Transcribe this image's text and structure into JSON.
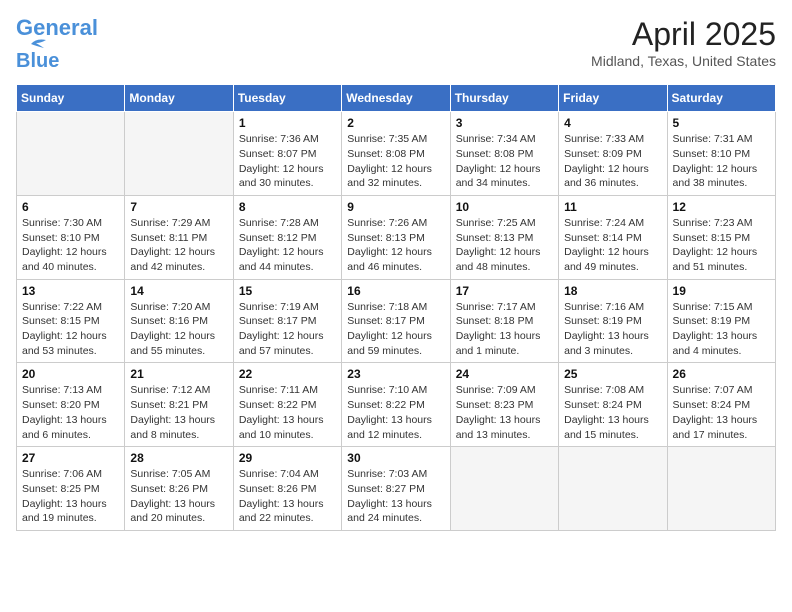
{
  "header": {
    "logo_line1": "General",
    "logo_line2": "Blue",
    "month_title": "April 2025",
    "location": "Midland, Texas, United States"
  },
  "days_of_week": [
    "Sunday",
    "Monday",
    "Tuesday",
    "Wednesday",
    "Thursday",
    "Friday",
    "Saturday"
  ],
  "weeks": [
    [
      {
        "day": "",
        "info": ""
      },
      {
        "day": "",
        "info": ""
      },
      {
        "day": "1",
        "info": "Sunrise: 7:36 AM\nSunset: 8:07 PM\nDaylight: 12 hours and 30 minutes."
      },
      {
        "day": "2",
        "info": "Sunrise: 7:35 AM\nSunset: 8:08 PM\nDaylight: 12 hours and 32 minutes."
      },
      {
        "day": "3",
        "info": "Sunrise: 7:34 AM\nSunset: 8:08 PM\nDaylight: 12 hours and 34 minutes."
      },
      {
        "day": "4",
        "info": "Sunrise: 7:33 AM\nSunset: 8:09 PM\nDaylight: 12 hours and 36 minutes."
      },
      {
        "day": "5",
        "info": "Sunrise: 7:31 AM\nSunset: 8:10 PM\nDaylight: 12 hours and 38 minutes."
      }
    ],
    [
      {
        "day": "6",
        "info": "Sunrise: 7:30 AM\nSunset: 8:10 PM\nDaylight: 12 hours and 40 minutes."
      },
      {
        "day": "7",
        "info": "Sunrise: 7:29 AM\nSunset: 8:11 PM\nDaylight: 12 hours and 42 minutes."
      },
      {
        "day": "8",
        "info": "Sunrise: 7:28 AM\nSunset: 8:12 PM\nDaylight: 12 hours and 44 minutes."
      },
      {
        "day": "9",
        "info": "Sunrise: 7:26 AM\nSunset: 8:13 PM\nDaylight: 12 hours and 46 minutes."
      },
      {
        "day": "10",
        "info": "Sunrise: 7:25 AM\nSunset: 8:13 PM\nDaylight: 12 hours and 48 minutes."
      },
      {
        "day": "11",
        "info": "Sunrise: 7:24 AM\nSunset: 8:14 PM\nDaylight: 12 hours and 49 minutes."
      },
      {
        "day": "12",
        "info": "Sunrise: 7:23 AM\nSunset: 8:15 PM\nDaylight: 12 hours and 51 minutes."
      }
    ],
    [
      {
        "day": "13",
        "info": "Sunrise: 7:22 AM\nSunset: 8:15 PM\nDaylight: 12 hours and 53 minutes."
      },
      {
        "day": "14",
        "info": "Sunrise: 7:20 AM\nSunset: 8:16 PM\nDaylight: 12 hours and 55 minutes."
      },
      {
        "day": "15",
        "info": "Sunrise: 7:19 AM\nSunset: 8:17 PM\nDaylight: 12 hours and 57 minutes."
      },
      {
        "day": "16",
        "info": "Sunrise: 7:18 AM\nSunset: 8:17 PM\nDaylight: 12 hours and 59 minutes."
      },
      {
        "day": "17",
        "info": "Sunrise: 7:17 AM\nSunset: 8:18 PM\nDaylight: 13 hours and 1 minute."
      },
      {
        "day": "18",
        "info": "Sunrise: 7:16 AM\nSunset: 8:19 PM\nDaylight: 13 hours and 3 minutes."
      },
      {
        "day": "19",
        "info": "Sunrise: 7:15 AM\nSunset: 8:19 PM\nDaylight: 13 hours and 4 minutes."
      }
    ],
    [
      {
        "day": "20",
        "info": "Sunrise: 7:13 AM\nSunset: 8:20 PM\nDaylight: 13 hours and 6 minutes."
      },
      {
        "day": "21",
        "info": "Sunrise: 7:12 AM\nSunset: 8:21 PM\nDaylight: 13 hours and 8 minutes."
      },
      {
        "day": "22",
        "info": "Sunrise: 7:11 AM\nSunset: 8:22 PM\nDaylight: 13 hours and 10 minutes."
      },
      {
        "day": "23",
        "info": "Sunrise: 7:10 AM\nSunset: 8:22 PM\nDaylight: 13 hours and 12 minutes."
      },
      {
        "day": "24",
        "info": "Sunrise: 7:09 AM\nSunset: 8:23 PM\nDaylight: 13 hours and 13 minutes."
      },
      {
        "day": "25",
        "info": "Sunrise: 7:08 AM\nSunset: 8:24 PM\nDaylight: 13 hours and 15 minutes."
      },
      {
        "day": "26",
        "info": "Sunrise: 7:07 AM\nSunset: 8:24 PM\nDaylight: 13 hours and 17 minutes."
      }
    ],
    [
      {
        "day": "27",
        "info": "Sunrise: 7:06 AM\nSunset: 8:25 PM\nDaylight: 13 hours and 19 minutes."
      },
      {
        "day": "28",
        "info": "Sunrise: 7:05 AM\nSunset: 8:26 PM\nDaylight: 13 hours and 20 minutes."
      },
      {
        "day": "29",
        "info": "Sunrise: 7:04 AM\nSunset: 8:26 PM\nDaylight: 13 hours and 22 minutes."
      },
      {
        "day": "30",
        "info": "Sunrise: 7:03 AM\nSunset: 8:27 PM\nDaylight: 13 hours and 24 minutes."
      },
      {
        "day": "",
        "info": ""
      },
      {
        "day": "",
        "info": ""
      },
      {
        "day": "",
        "info": ""
      }
    ]
  ]
}
